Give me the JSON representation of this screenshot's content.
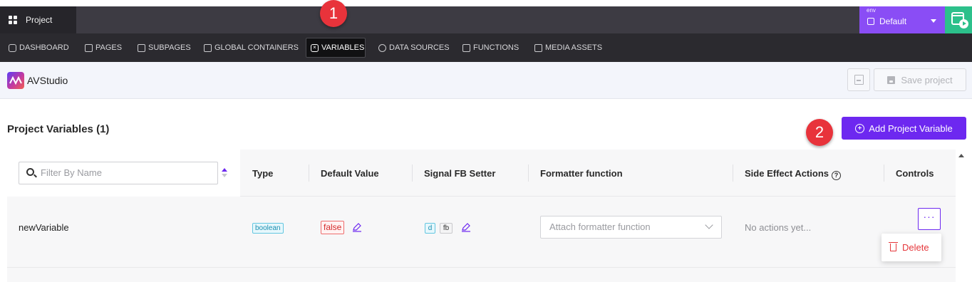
{
  "topbar": {
    "project_label": "Project",
    "env_label": "env",
    "env_value": "Default"
  },
  "nav": {
    "items": [
      {
        "label": "DASHBOARD",
        "icon": "home-icon"
      },
      {
        "label": "PAGES",
        "icon": "page-icon"
      },
      {
        "label": "SUBPAGES",
        "icon": "subpage-icon"
      },
      {
        "label": "GLOBAL CONTAINERS",
        "icon": "container-icon"
      },
      {
        "label": "VARIABLES",
        "icon": "variable-icon",
        "active": true
      },
      {
        "label": "DATA SOURCES",
        "icon": "database-icon"
      },
      {
        "label": "FUNCTIONS",
        "icon": "function-icon"
      },
      {
        "label": "MEDIA ASSETS",
        "icon": "image-icon"
      }
    ]
  },
  "header": {
    "app_name": "AVStudio",
    "save_label": "Save project"
  },
  "section": {
    "title": "Project Variables (1)",
    "add_label": "Add Project Variable"
  },
  "annotations": {
    "marker_1": "1",
    "marker_2": "2"
  },
  "table": {
    "filter_placeholder": "Filter By Name",
    "columns": [
      "Type",
      "Default Value",
      "Signal FB Setter",
      "Formatter function",
      "Side Effect Actions",
      "Controls"
    ],
    "rows": [
      {
        "name": "newVariable",
        "type": "boolean",
        "default_value": "false",
        "setter_d": "d",
        "setter_fb": "fb",
        "formatter_placeholder": "Attach formatter function",
        "side_effects": "No actions yet...",
        "controls_label": "···"
      }
    ],
    "context_menu": {
      "delete_label": "Delete"
    }
  },
  "colors": {
    "accent": "#6d28f0",
    "env": "#8a4df5",
    "preview": "#2cc08b",
    "marker": "#e8333b",
    "danger": "#e5363a"
  }
}
